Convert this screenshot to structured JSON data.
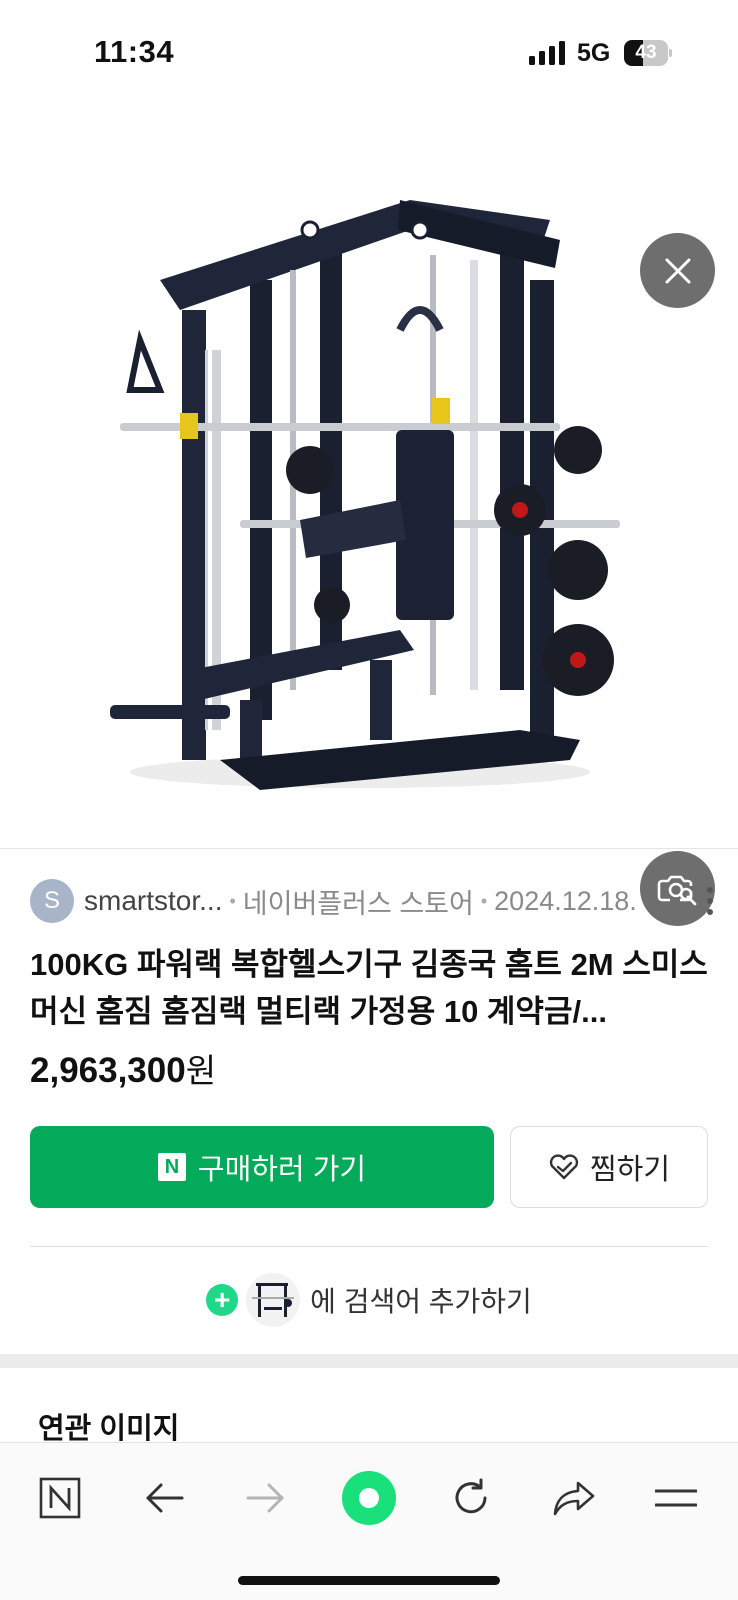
{
  "status_bar": {
    "time": "11:34",
    "network": "5G",
    "battery_level": "43",
    "battery_fraction": 0.43
  },
  "image_viewer": {
    "image_subject": "smith machine power rack home gym",
    "close_icon": "close-icon",
    "lens_icon": "image-search-icon"
  },
  "product": {
    "avatar_letter": "S",
    "source": "smartstor...",
    "store": "네이버플러스 스토어",
    "date": "2024.12.18.",
    "title": "100KG 파워랙 복합헬스기구 김종국 홈트 2M 스미스머신 홈짐 홈짐랙 멀티랙 가정용 10 계약금/...",
    "price_number": "2,963,300",
    "price_unit": "원"
  },
  "actions": {
    "buy_logo": "N",
    "buy_label": "구매하러 가기",
    "wish_label": "찜하기",
    "add_search_label": "에 검색어 추가하기"
  },
  "sections": {
    "related_title": "연관 이미지"
  },
  "toolbar": {
    "items": [
      "naver-home-icon",
      "back-arrow-icon",
      "forward-arrow-icon",
      "green-dot-icon",
      "refresh-icon",
      "share-icon",
      "menu-icon"
    ]
  },
  "colors": {
    "accent_green": "#03aa5a",
    "mint": "#1fd88a",
    "overlay_button": "#6e6e6e"
  }
}
